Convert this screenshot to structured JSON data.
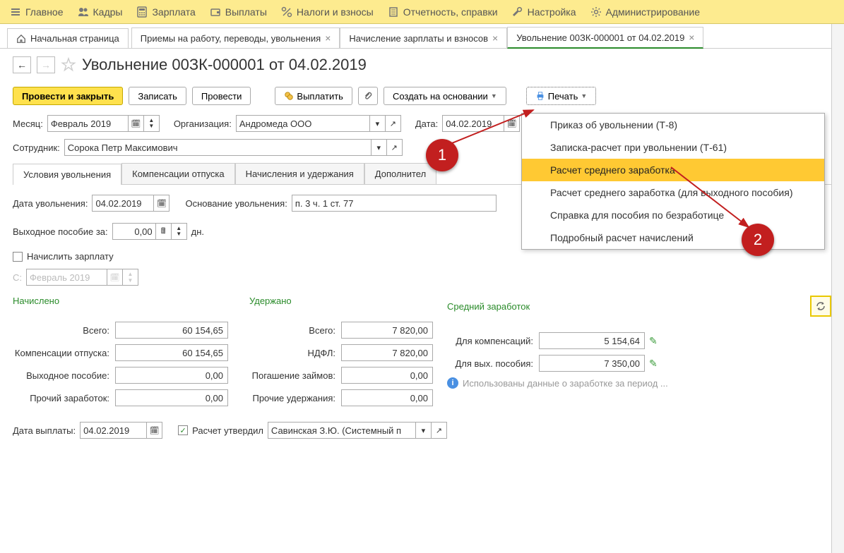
{
  "menu": {
    "main": "Главное",
    "staff": "Кадры",
    "salary": "Зарплата",
    "payments": "Выплаты",
    "taxes": "Налоги и взносы",
    "reports": "Отчетность, справки",
    "settings": "Настройка",
    "admin": "Администрирование"
  },
  "tabs": {
    "home": "Начальная страница",
    "t1": "Приемы на работу, переводы, увольнения",
    "t2": "Начисление зарплаты и взносов",
    "t3": "Увольнение 00ЗК-000001 от 04.02.2019"
  },
  "title": "Увольнение 00ЗК-000001 от 04.02.2019",
  "toolbar": {
    "post_close": "Провести и закрыть",
    "save": "Записать",
    "post": "Провести",
    "pay": "Выплатить",
    "create_based": "Создать на основании",
    "print": "Печать"
  },
  "form": {
    "month_lbl": "Месяц:",
    "month_val": "Февраль 2019",
    "org_lbl": "Организация:",
    "org_val": "Андромеда ООО",
    "date_lbl": "Дата:",
    "date_val": "04.02.2019",
    "emp_lbl": "Сотрудник:",
    "emp_val": "Сорока Петр Максимович"
  },
  "inner_tabs": {
    "t1": "Условия увольнения",
    "t2": "Компенсации отпуска",
    "t3": "Начисления и удержания",
    "t4": "Дополнител"
  },
  "panel": {
    "dismiss_date_lbl": "Дата увольнения:",
    "dismiss_date_val": "04.02.2019",
    "basis_lbl": "Основание увольнения:",
    "basis_val": "п. 3 ч. 1 ст. 77",
    "severance_lbl": "Выходное пособие за:",
    "severance_val": "0,00",
    "days": "дн.",
    "accrue_salary": "Начислить зарплату",
    "from_lbl": "С:",
    "from_val": "Февраль 2019"
  },
  "accrued": {
    "hdr": "Начислено",
    "total_lbl": "Всего:",
    "total_val": "60 154,65",
    "comp_lbl": "Компенсации отпуска:",
    "comp_val": "60 154,65",
    "sev_lbl": "Выходное пособие:",
    "sev_val": "0,00",
    "other_lbl": "Прочий заработок:",
    "other_val": "0,00"
  },
  "withheld": {
    "hdr": "Удержано",
    "total_lbl": "Всего:",
    "total_val": "7 820,00",
    "ndfl_lbl": "НДФЛ:",
    "ndfl_val": "7 820,00",
    "loan_lbl": "Погашение займов:",
    "loan_val": "0,00",
    "other_lbl": "Прочие удержания:",
    "other_val": "0,00"
  },
  "average": {
    "hdr": "Средний заработок",
    "comp_lbl": "Для компенсаций:",
    "comp_val": "5 154,64",
    "sev_lbl": "Для вых. пособия:",
    "sev_val": "7 350,00",
    "info": "Использованы данные о заработке за период ..."
  },
  "footer": {
    "paydate_lbl": "Дата выплаты:",
    "paydate_val": "04.02.2019",
    "approved": "Расчет утвердил",
    "approver": "Савинская З.Ю. (Системный п"
  },
  "print_menu": {
    "i1": "Приказ об увольнении (Т-8)",
    "i2": "Записка-расчет при увольнении (Т-61)",
    "i3": "Расчет среднего заработка",
    "i4": "Расчет среднего заработка (для выходного пособия)",
    "i5": "Справка для пособия по безработице",
    "i6": "Подробный расчет начислений"
  },
  "callouts": {
    "c1": "1",
    "c2": "2"
  }
}
